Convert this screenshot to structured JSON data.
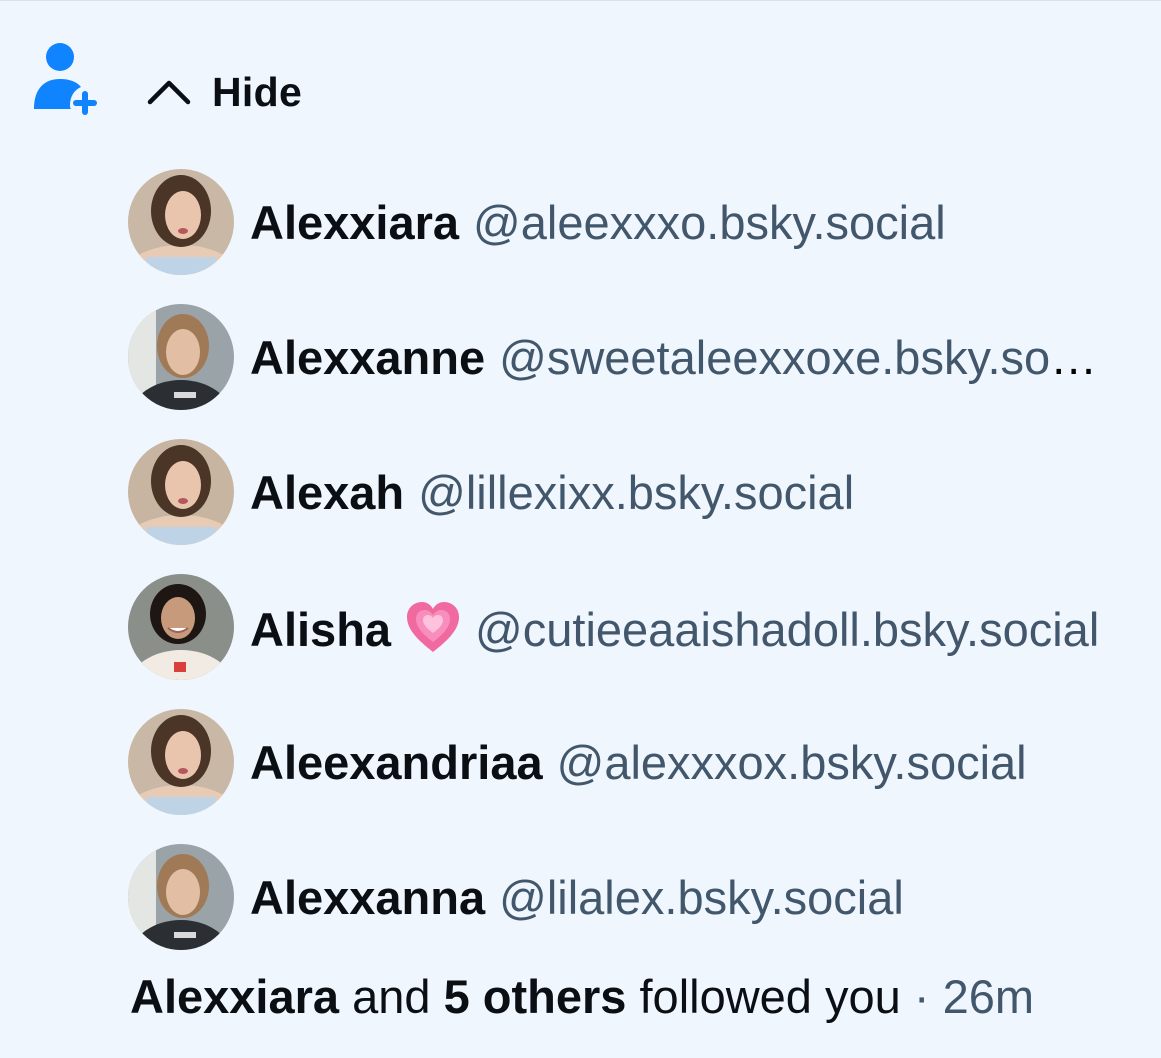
{
  "colors": {
    "background": "#f0f6fd",
    "accent": "#1083fe",
    "text_primary": "#0b0f14",
    "text_secondary": "#42576c"
  },
  "notification": {
    "icon": "person-plus-icon",
    "toggle_label": "Hide",
    "toggle_icon": "chevron-up-icon",
    "followers": [
      {
        "display_name": "Alexxiara",
        "handle": "@aleexxxo.bsky.social",
        "emoji": ""
      },
      {
        "display_name": "Alexxanne",
        "handle": "@sweetaleexxoxe.bsky.social",
        "emoji": ""
      },
      {
        "display_name": "Alexah",
        "handle": "@lillexixx.bsky.social",
        "emoji": ""
      },
      {
        "display_name": "Alisha",
        "handle": "@cutieeaaishadoll.bsky.social",
        "emoji": "growing-heart-emoji"
      },
      {
        "display_name": "Aleexandriaa",
        "handle": "@alexxxox.bsky.social",
        "emoji": ""
      },
      {
        "display_name": "Alexxanna",
        "handle": "@lilalex.bsky.social",
        "emoji": ""
      }
    ],
    "summary": {
      "first_name": "Alexxiara",
      "and_text": "and",
      "others_text": "5 others",
      "action_text": "followed you",
      "separator": "·",
      "time": "26m"
    }
  }
}
